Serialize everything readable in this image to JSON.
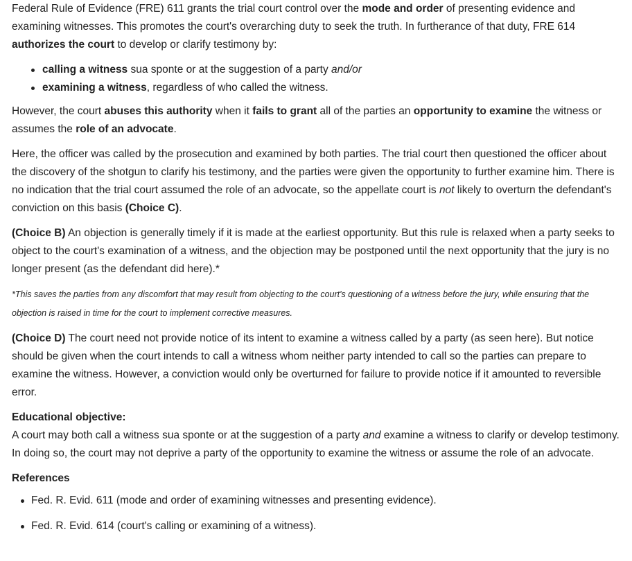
{
  "intro": {
    "t1": "Federal Rule of Evidence (FRE) 611 grants the trial court control over the ",
    "b1": "mode and order",
    "t2": " of presenting evidence and examining witnesses.  This promotes the court's overarching duty to seek the truth.  In furtherance of that duty, FRE 614 ",
    "b2": "authorizes the court",
    "t3": " to develop or clarify testimony by:"
  },
  "bullets": [
    {
      "bold": "calling a witness",
      "text": " sua sponte or at the suggestion of a party ",
      "italic": "and/or"
    },
    {
      "bold": "examining a witness",
      "text": ", regardless of who called the witness.",
      "italic": ""
    }
  ],
  "however": {
    "t1": "However, the court ",
    "b1": "abuses this authority",
    "t2": " when it ",
    "b2": "fails to grant",
    "t3": " all of the parties an ",
    "b3": "opportunity to examine",
    "t4": " the witness or assumes the ",
    "b4": "role of an advocate",
    "t5": "."
  },
  "here": {
    "t1": "Here, the officer was called by the prosecution and examined by both parties.  The trial court then questioned the officer about the discovery of the shotgun to clarify his testimony, and the parties were given the opportunity to further examine him.  There is no indication that the trial court assumed the role of an advocate, so the appellate court is ",
    "i1": "not",
    "t2": " likely to overturn the defendant's conviction on this basis ",
    "b1": "(Choice C)",
    "t3": "."
  },
  "choice_b": {
    "label": "(Choice B)",
    "text": "  An objection is generally timely if it is made at the earliest opportunity.  But this rule is relaxed when a party seeks to object to the court's examination of a witness, and the objection may be postponed until the next opportunity that the jury is no longer present (as the defendant did here).*"
  },
  "footnote": "*This saves the parties from any discomfort that may result from objecting to the court's questioning of a witness before the jury, while ensuring that the objection is raised in time for the court to implement corrective measures.",
  "choice_d": {
    "label": "(Choice D)",
    "text": "  The court need not provide notice of its intent to examine a witness called by a party (as seen here).  But notice should be given when the court intends to call a witness whom neither party intended to call so the parties can prepare to examine the witness.  However, a conviction would only be overturned for failure to provide notice if it amounted to reversible error."
  },
  "objective": {
    "heading": "Educational objective:",
    "t1": "A court may both call a witness sua sponte or at the suggestion of a party ",
    "i1": "and",
    "t2": " examine a witness to clarify or develop testimony.  In doing so, the court may not deprive a party of the opportunity to examine the witness or assume the role of an advocate."
  },
  "references": {
    "heading": "References",
    "items": [
      "Fed. R. Evid. 611 (mode and order of examining witnesses and presenting evidence).",
      "Fed. R. Evid. 614 (court's calling or examining of a witness)."
    ]
  }
}
